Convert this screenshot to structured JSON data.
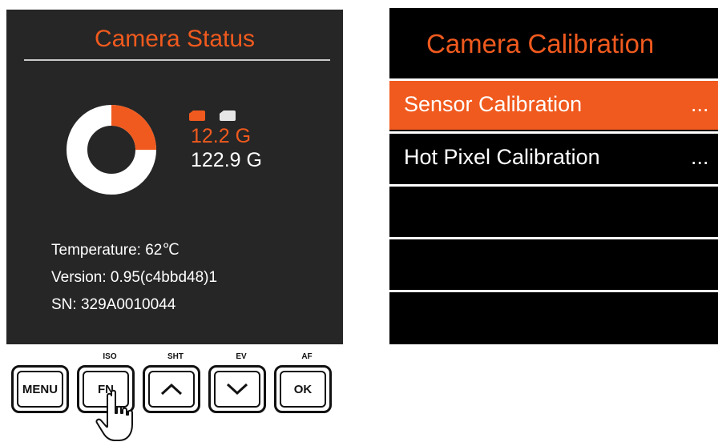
{
  "status_screen": {
    "title": "Camera Status",
    "storage": {
      "used_label": "12.2 G",
      "total_label": "122.9 G",
      "used_fraction": 0.25,
      "used_color": "#f05a1e",
      "free_color": "#ffffff"
    },
    "info": {
      "temperature": "Temperature: 62℃",
      "version": "Version: 0.95(c4bbd48)1",
      "serial": "SN: 329A0010044"
    }
  },
  "buttons": [
    {
      "caption": "",
      "label": "MENU",
      "icon": ""
    },
    {
      "caption": "ISO",
      "label": "FN",
      "icon": ""
    },
    {
      "caption": "SHT",
      "label": "",
      "icon": "chevron-up-icon"
    },
    {
      "caption": "EV",
      "label": "",
      "icon": "chevron-down-icon"
    },
    {
      "caption": "AF",
      "label": "OK",
      "icon": ""
    }
  ],
  "calibration_screen": {
    "title": "Camera Calibration",
    "items": [
      {
        "label": "Sensor Calibration",
        "dots": "...",
        "selected": true
      },
      {
        "label": "Hot Pixel Calibration",
        "dots": "...",
        "selected": false
      },
      {
        "label": "",
        "dots": "",
        "selected": false
      },
      {
        "label": "",
        "dots": "",
        "selected": false
      },
      {
        "label": "",
        "dots": "",
        "selected": false
      }
    ]
  },
  "colors": {
    "accent": "#f05a1e",
    "status_bg": "#262626",
    "calibration_bg": "#000000"
  }
}
